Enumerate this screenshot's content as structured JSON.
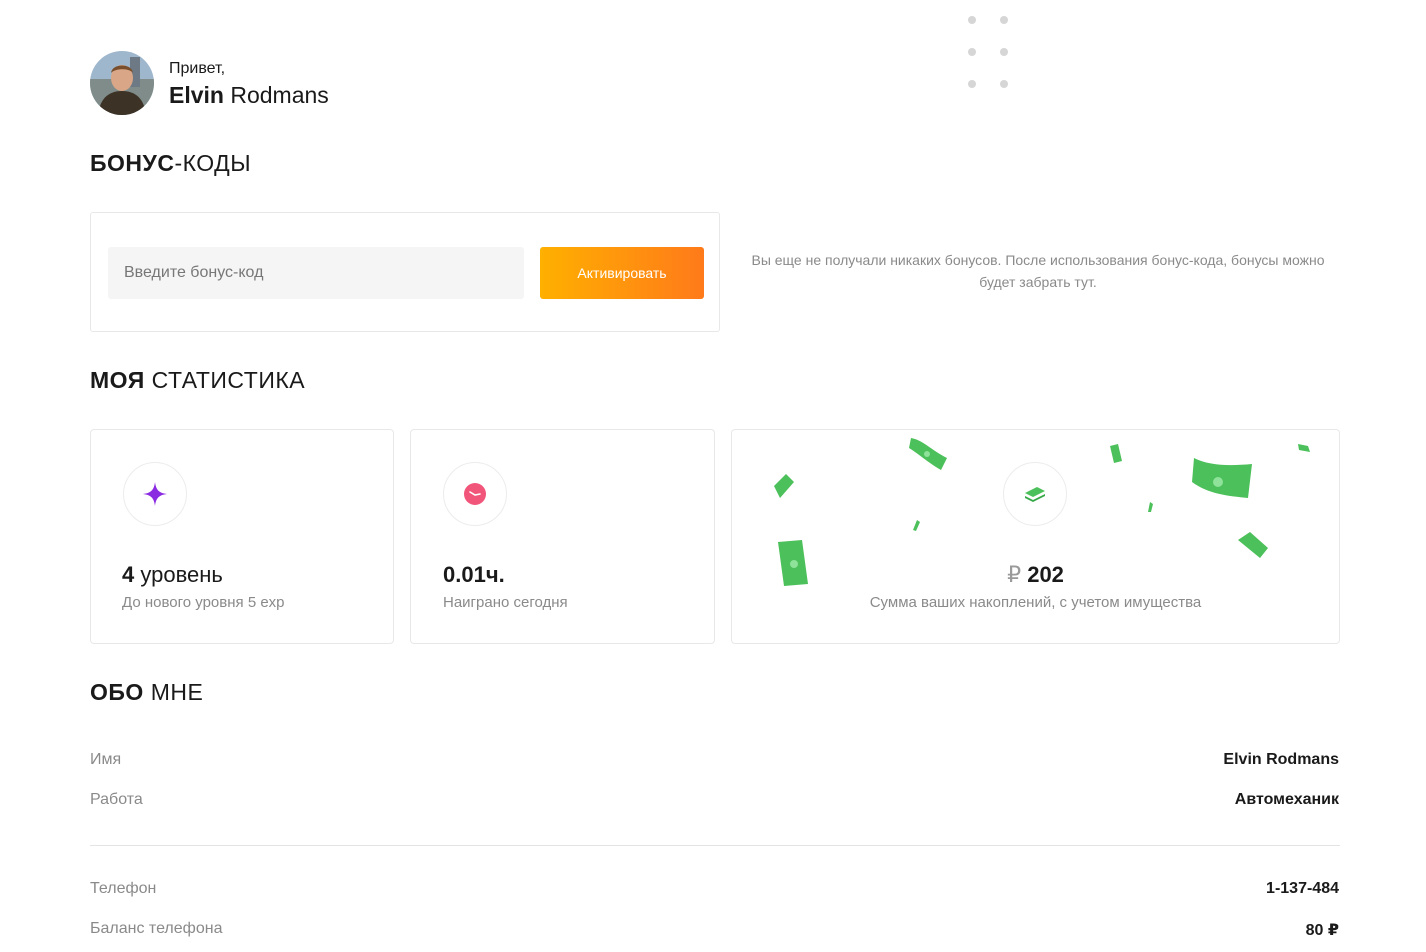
{
  "header": {
    "greeting": "Привет,",
    "first_name": "Elvin",
    "last_name": "Rodmans"
  },
  "bonus": {
    "title_bold": "БОНУС",
    "title_rest": "-КОДЫ",
    "input_placeholder": "Введите бонус-код",
    "button_label": "Активировать",
    "empty_note": "Вы еще не получали никаких бонусов. После использования бонус-кода, бонусы можно будет забрать тут."
  },
  "stats": {
    "title_bold": "МОЯ",
    "title_rest": " СТАТИСТИКА",
    "level": {
      "value": "4",
      "unit": " уровень",
      "sub": "До нового уровня 5 exp",
      "icon": "sparkle-icon"
    },
    "playtime": {
      "value": "0.01ч.",
      "sub": "Наиграно сегодня",
      "icon": "clock-icon"
    },
    "savings": {
      "currency": "₽",
      "value": "202",
      "sub": "Сумма ваших накоплений, с учетом имущества",
      "icon": "cash-icon"
    }
  },
  "about": {
    "title_bold": "ОБО",
    "title_rest": " МНЕ",
    "rows": [
      {
        "label": "Имя",
        "value": "Elvin Rodmans"
      },
      {
        "label": "Работа",
        "value": "Автомеханик"
      },
      {
        "label": "Телефон",
        "value": "1-137-484"
      },
      {
        "label": "Баланс телефона",
        "value": "80 ₽"
      }
    ]
  },
  "colors": {
    "accent_start": "#ffb000",
    "accent_end": "#ff7a1a",
    "level_icon": "#8a2be2",
    "clock_icon": "#f2557a",
    "money": "#4cc05a"
  }
}
